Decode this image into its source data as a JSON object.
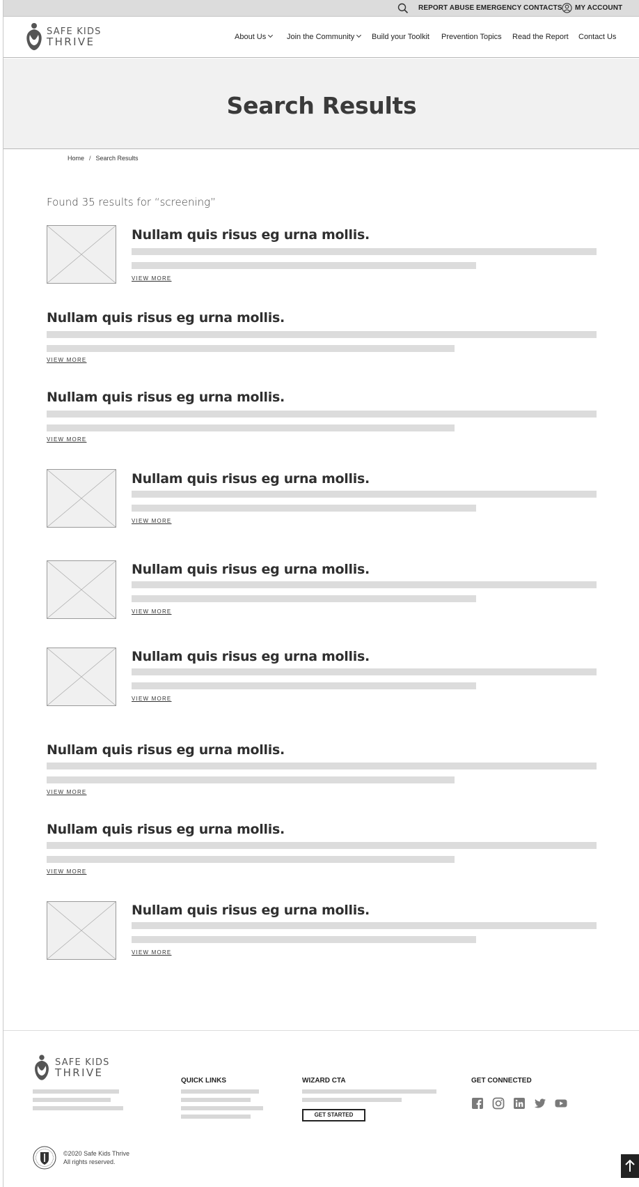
{
  "utility_bar": {
    "links": [
      "REPORT ABUSE",
      "EMERGENCY CONTACTS",
      "MY ACCOUNT"
    ]
  },
  "header": {
    "logo": {
      "line1": "SAFE KIDS",
      "line2": "THRIVE"
    },
    "nav": [
      "About Us",
      "Join the Community",
      "Build your Toolkit",
      "Prevention Topics",
      "Read the Report",
      "Contact Us"
    ]
  },
  "hero": {
    "title": "Search Results"
  },
  "breadcrumb": {
    "home": "Home",
    "current": "Search Results",
    "separator": "/"
  },
  "summary": "Found 35 results for “screening”",
  "results": [
    {
      "title": "Nullam quis risus eg urna mollis.",
      "link": "VIEW MORE",
      "has_image": true
    },
    {
      "title": "Nullam quis risus eg urna mollis.",
      "link": "VIEW MORE",
      "has_image": false
    },
    {
      "title": "Nullam quis risus eg urna mollis.",
      "link": "VIEW MORE",
      "has_image": false
    },
    {
      "title": "Nullam quis risus eg urna mollis.",
      "link": "VIEW MORE",
      "has_image": true
    },
    {
      "title": "Nullam quis risus eg urna mollis.",
      "link": "VIEW MORE",
      "has_image": true
    },
    {
      "title": "Nullam quis risus eg urna mollis.",
      "link": "VIEW MORE",
      "has_image": true
    },
    {
      "title": "Nullam quis risus eg urna mollis.",
      "link": "VIEW MORE",
      "has_image": false
    },
    {
      "title": "Nullam quis risus eg urna mollis.",
      "link": "VIEW MORE",
      "has_image": false
    },
    {
      "title": "Nullam quis risus eg urna mollis.",
      "link": "VIEW MORE",
      "has_image": true
    }
  ],
  "footer": {
    "logo": {
      "line1": "SAFE KIDS",
      "line2": "THRIVE"
    },
    "quick_links_heading": "QUICK LINKS",
    "wizard_heading": "WIZARD CTA",
    "wizard_button": "GET STARTED",
    "connected_heading": "GET CONNECTED",
    "social_icons": [
      "facebook-icon",
      "instagram-icon",
      "linkedin-icon",
      "twitter-icon",
      "youtube-icon"
    ],
    "copyright_line1": "©2020 Safe Kids Thrive",
    "copyright_line2": "All rights reserved."
  },
  "colors": {
    "utility_bg": "#dcdcdc",
    "hero_bg": "#f1f1f1",
    "placeholder_bar": "#dcdcdc",
    "text_dark": "#2f2f2f"
  }
}
